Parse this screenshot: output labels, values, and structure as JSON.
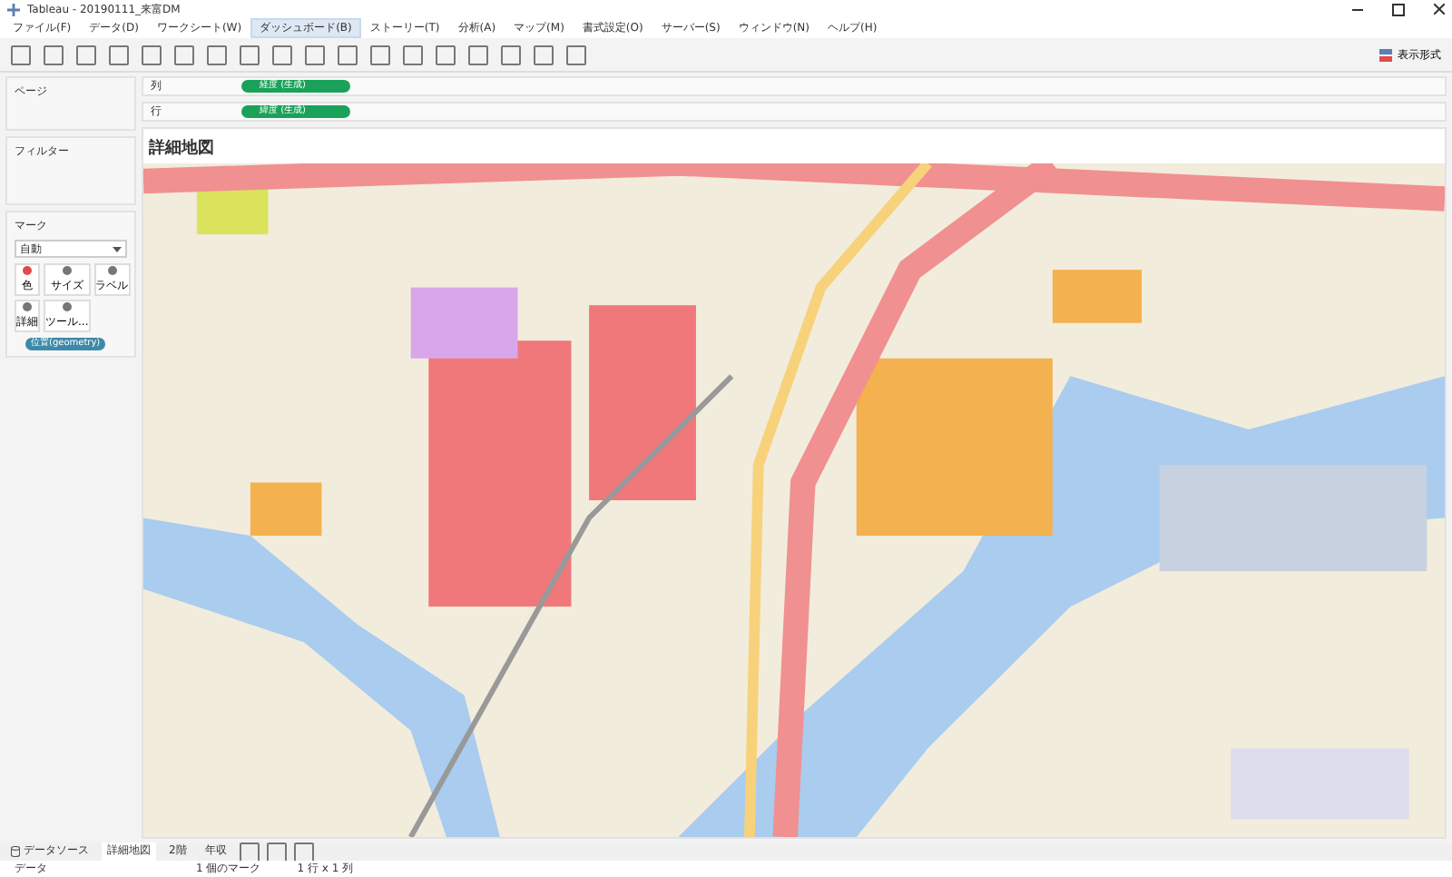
{
  "window": {
    "title": "Tableau - 20190111_来富DM"
  },
  "menu": [
    {
      "label": "ファイル(F)",
      "selected": false
    },
    {
      "label": "データ(D)",
      "selected": false
    },
    {
      "label": "ワークシート(W)",
      "selected": false
    },
    {
      "label": "ダッシュボード(B)",
      "selected": true
    },
    {
      "label": "ストーリー(T)",
      "selected": false
    },
    {
      "label": "分析(A)",
      "selected": false
    },
    {
      "label": "マップ(M)",
      "selected": false
    },
    {
      "label": "書式設定(O)",
      "selected": false
    },
    {
      "label": "サーバー(S)",
      "selected": false
    },
    {
      "label": "ウィンドウ(N)",
      "selected": false
    },
    {
      "label": "ヘルプ(H)",
      "selected": false
    }
  ],
  "toolbar": {
    "show_me": "表示形式"
  },
  "pages_label": "ページ",
  "shelves": [
    {
      "label": "列",
      "pill": "経度 (生成)"
    },
    {
      "label": "行",
      "pill": "緯度 (生成)"
    }
  ],
  "filters_label": "フィルター",
  "marks": {
    "label": "マーク",
    "type": "自動",
    "cards": [
      "色",
      "サイズ",
      "ラベル",
      "詳細",
      "ツール..."
    ],
    "pill": "位置(geometry)"
  },
  "sheet_title": "詳細地図",
  "tabs": [
    {
      "label": "データソース",
      "kind": "source",
      "selected": false
    },
    {
      "label": "詳細地図",
      "kind": "sheet",
      "selected": true
    },
    {
      "label": "2階",
      "kind": "sheet",
      "selected": false
    },
    {
      "label": "年収",
      "kind": "sheet",
      "selected": false
    }
  ],
  "status_bar": {
    "source": "データ",
    "marks": "1 個のマーク",
    "dims": "1 行 x 1 列"
  }
}
